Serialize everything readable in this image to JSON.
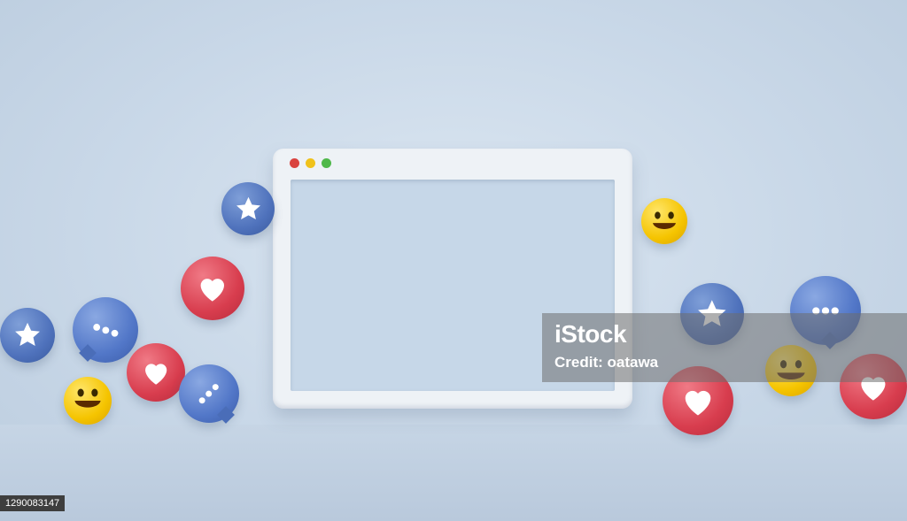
{
  "watermark": {
    "brand": "iStock",
    "credit": "Credit: oatawa"
  },
  "image_id": "1290083147",
  "colors": {
    "window_red": "#d9433f",
    "window_yellow": "#f0c21b",
    "window_green": "#4fb84a"
  },
  "icons": [
    "star-icon",
    "heart-icon",
    "chat-dots-icon",
    "smiley-emoji-icon"
  ]
}
